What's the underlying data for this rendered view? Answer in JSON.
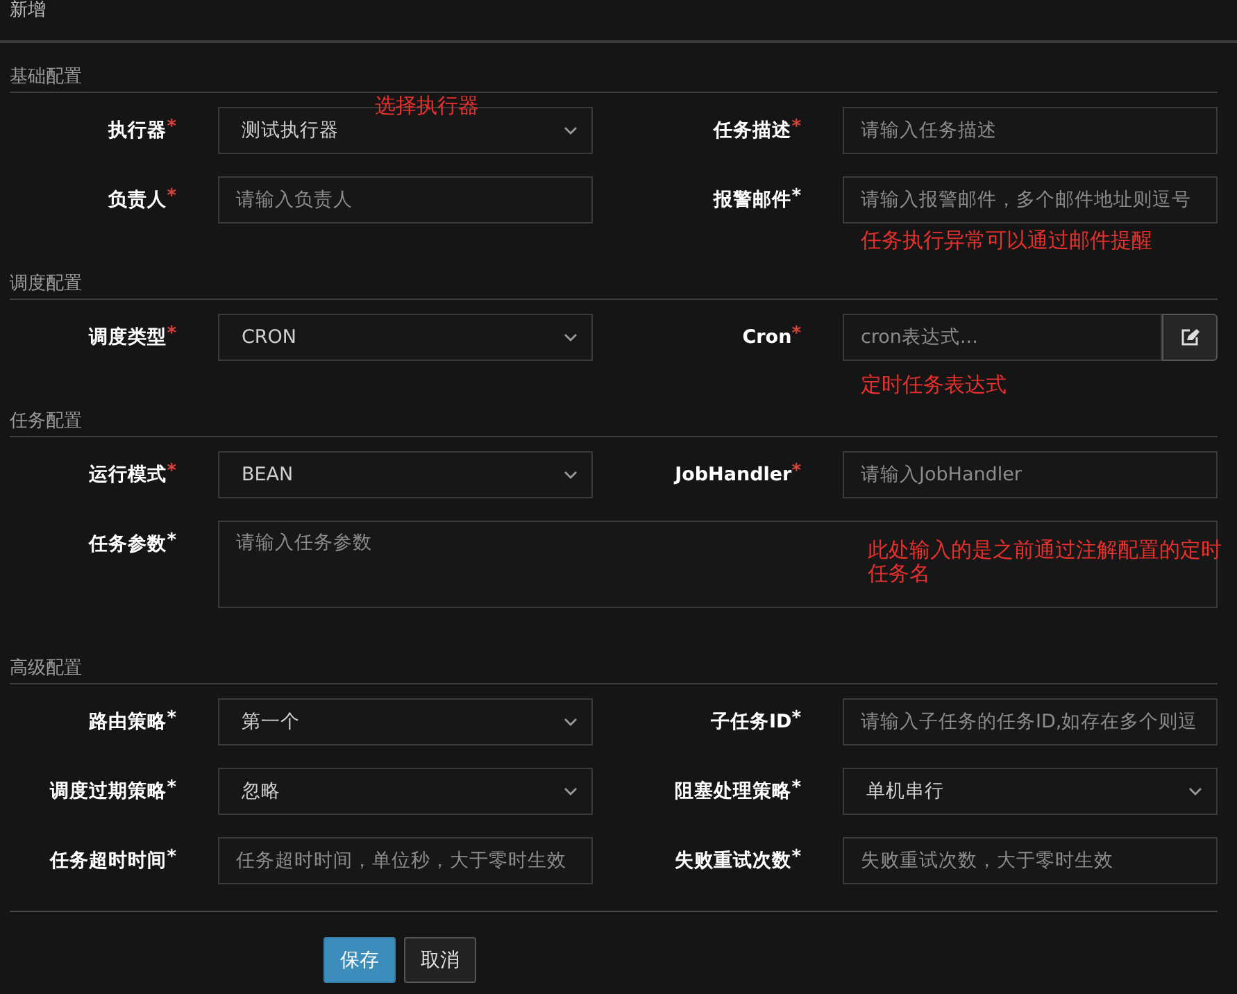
{
  "dialog": {
    "title": "新增"
  },
  "sections": [
    {
      "title": "基础配置",
      "fields": [
        {
          "label": "执行器",
          "required": {
            "text": "*",
            "color": "#d9443c"
          },
          "kind": "select",
          "value": "测试执行器",
          "note": {
            "text": "选择执行器",
            "kind": "beside"
          }
        },
        {
          "label": "任务描述",
          "required": {
            "text": "*",
            "color": "#d9443c"
          },
          "kind": "input",
          "placeholder": "请输入任务描述"
        },
        {
          "label": "负责人",
          "required": {
            "text": "*",
            "color": "#d9443c"
          },
          "kind": "input",
          "placeholder": "请输入负责人"
        },
        {
          "label": "报警邮件",
          "required": {
            "text": "*",
            "color": "#ffffff"
          },
          "kind": "input",
          "placeholder": "请输入报警邮件，多个邮件地址则逗号",
          "note": {
            "text": "任务执行异常可以通过邮件提醒",
            "kind": "below"
          }
        }
      ]
    },
    {
      "title": "调度配置",
      "fields": [
        {
          "label": "调度类型",
          "required": {
            "text": "*",
            "color": "#d9443c"
          },
          "kind": "select",
          "value": "CRON"
        },
        {
          "label": "Cron",
          "required": {
            "text": "*",
            "color": "#d9443c"
          },
          "kind": "input_button",
          "placeholder": "cron表达式...",
          "note": {
            "text": "定时任务表达式",
            "kind": "below"
          }
        }
      ]
    },
    {
      "title": "任务配置",
      "fields": [
        {
          "label": "运行模式",
          "required": {
            "text": "*",
            "color": "#d9443c"
          },
          "kind": "select",
          "value": "BEAN"
        },
        {
          "label": "JobHandler",
          "required": {
            "text": "*",
            "color": "#d9443c"
          },
          "kind": "input",
          "placeholder": "请输入JobHandler",
          "note": {
            "text": "此处输入的是之前通过注解配置的定时任务名",
            "kind": "overlay"
          }
        },
        {
          "label": "任务参数",
          "required": {
            "text": "*",
            "color": "#ffffff"
          },
          "kind": "textarea",
          "placeholder": "请输入任务参数"
        }
      ]
    },
    {
      "title": "高级配置",
      "fields": [
        {
          "label": "路由策略",
          "required": {
            "text": "*",
            "color": "#ffffff"
          },
          "kind": "select",
          "value": "第一个"
        },
        {
          "label": "子任务ID",
          "required": {
            "text": "*",
            "color": "#ffffff"
          },
          "kind": "input",
          "placeholder": "请输入子任务的任务ID,如存在多个则逗"
        },
        {
          "label": "调度过期策略",
          "required": {
            "text": "*",
            "color": "#ffffff"
          },
          "kind": "select",
          "value": "忽略"
        },
        {
          "label": "阻塞处理策略",
          "required": {
            "text": "*",
            "color": "#ffffff"
          },
          "kind": "select",
          "value": "单机串行"
        },
        {
          "label": "任务超时时间",
          "required": {
            "text": "*",
            "color": "#ffffff"
          },
          "kind": "input",
          "placeholder": "任务超时时间，单位秒，大于零时生效"
        },
        {
          "label": "失败重试次数",
          "required": {
            "text": "*",
            "color": "#ffffff"
          },
          "kind": "input",
          "placeholder": "失败重试次数，大于零时生效"
        }
      ]
    }
  ],
  "buttons": [
    {
      "label": "保存",
      "kind": "primary"
    },
    {
      "label": "取消",
      "kind": "default"
    }
  ]
}
